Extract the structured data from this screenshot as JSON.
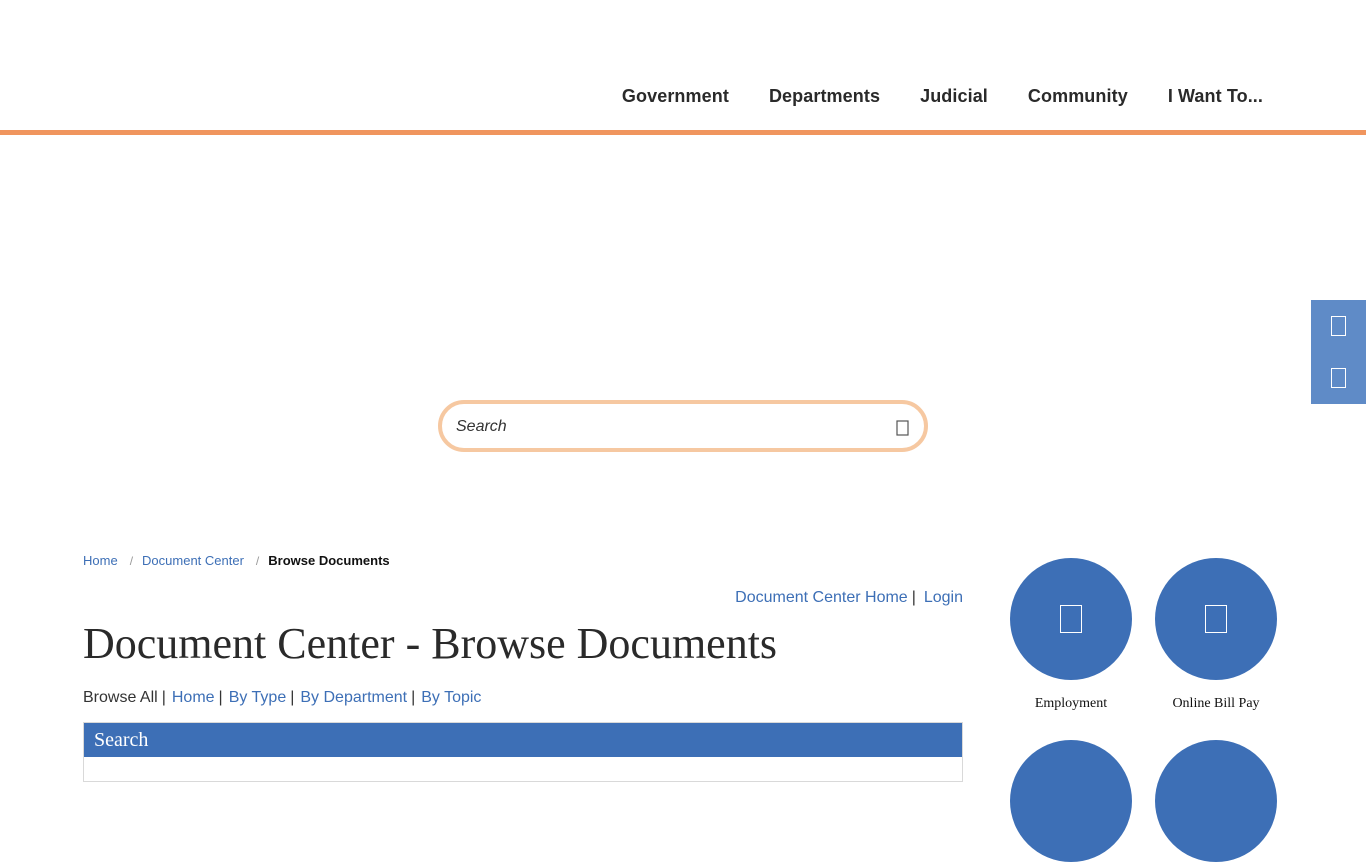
{
  "nav": {
    "items": [
      "Government",
      "Departments",
      "Judicial",
      "Community",
      "I Want To..."
    ]
  },
  "side_tools": {
    "icons": [
      "side-tool-icon-1",
      "side-tool-icon-2"
    ]
  },
  "search": {
    "placeholder": "Search",
    "icon": "search-icon"
  },
  "breadcrumb": {
    "items": [
      "Home",
      "Document Center"
    ],
    "current": "Browse Documents"
  },
  "top_links": {
    "home": "Document Center Home",
    "separator": "|",
    "login": "Login"
  },
  "page": {
    "title": "Document Center - Browse Documents"
  },
  "browse": {
    "all": "Browse All",
    "links": [
      "Home",
      "By Type",
      "By Department",
      "By Topic"
    ],
    "separator": "|"
  },
  "search_panel": {
    "title": "Search"
  },
  "quick_links": [
    {
      "label": "Employment",
      "icon": "employment-icon"
    },
    {
      "label": "Online Bill Pay",
      "icon": "bill-pay-icon"
    }
  ],
  "colors": {
    "accent_orange": "#f0955e",
    "primary_blue": "#3d6fb6",
    "side_tools_blue": "#5f8bc7",
    "search_border": "#f6c8a1"
  }
}
